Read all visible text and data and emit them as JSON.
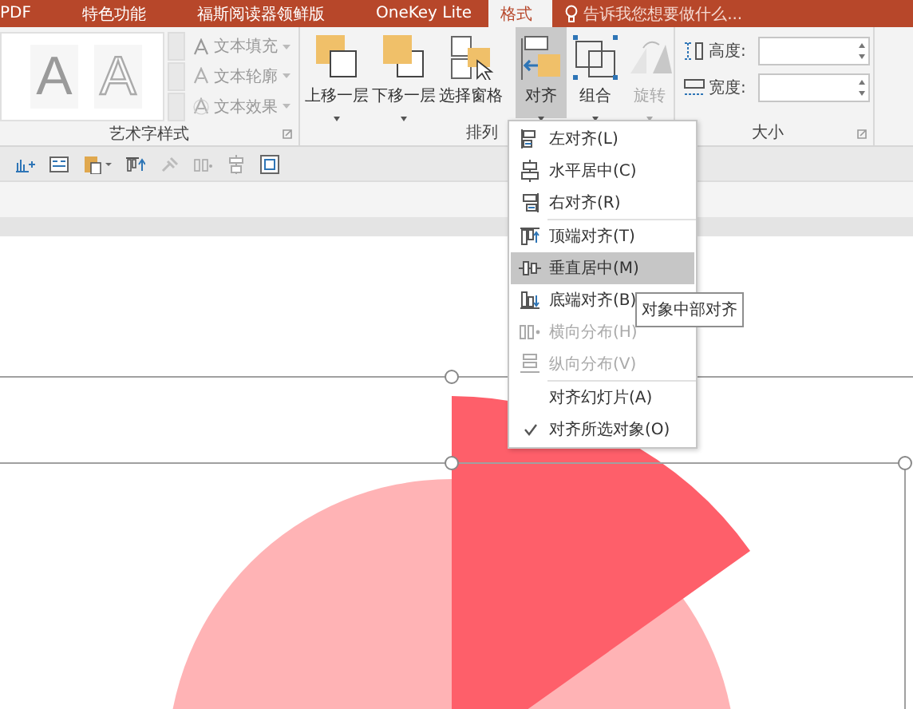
{
  "tabs": [
    {
      "label": "PDF",
      "selected": false
    },
    {
      "label": "特色功能",
      "selected": false
    },
    {
      "label": "福斯阅读器领鲜版",
      "selected": false
    },
    {
      "label": "OneKey Lite",
      "selected": false
    },
    {
      "label": "格式",
      "selected": true
    }
  ],
  "tell_me": {
    "placeholder": "告诉我您想要做什么..."
  },
  "wordart_group": {
    "label": "艺术字样式",
    "gallery": [
      {
        "label": "A"
      },
      {
        "label": "A"
      }
    ],
    "commands": [
      {
        "label": "文本填充"
      },
      {
        "label": "文本轮廓"
      },
      {
        "label": "文本效果"
      }
    ]
  },
  "arrange_group": {
    "label": "排列",
    "buttons": [
      {
        "label": "上移一层",
        "selected": false,
        "disabled": false,
        "dropdown": true
      },
      {
        "label": "下移一层",
        "selected": false,
        "disabled": false,
        "dropdown": true
      },
      {
        "label": "选择窗格",
        "selected": false,
        "disabled": false,
        "dropdown": false
      },
      {
        "label": "对齐",
        "selected": true,
        "disabled": false,
        "dropdown": true
      },
      {
        "label": "组合",
        "selected": false,
        "disabled": false,
        "dropdown": true
      },
      {
        "label": "旋转",
        "selected": false,
        "disabled": true,
        "dropdown": true
      }
    ]
  },
  "size_group": {
    "label": "大小",
    "fields": [
      {
        "label": "高度:"
      },
      {
        "label": "宽度:"
      }
    ]
  },
  "align_menu": {
    "sections": [
      {
        "items": [
          {
            "label": "左对齐(L)",
            "selected": false,
            "disabled": false,
            "checked": false
          },
          {
            "label": "水平居中(C)",
            "selected": false,
            "disabled": false,
            "checked": false
          },
          {
            "label": "右对齐(R)",
            "selected": false,
            "disabled": false,
            "checked": false
          }
        ]
      },
      {
        "items": [
          {
            "label": "顶端对齐(T)",
            "selected": false,
            "disabled": false,
            "checked": false
          },
          {
            "label": "垂直居中(M)",
            "selected": true,
            "disabled": false,
            "checked": false
          },
          {
            "label": "底端对齐(B)",
            "selected": false,
            "disabled": false,
            "checked": false
          },
          {
            "label": "横向分布(H)",
            "selected": false,
            "disabled": true,
            "checked": false
          },
          {
            "label": "纵向分布(V)",
            "selected": false,
            "disabled": true,
            "checked": false
          }
        ]
      },
      {
        "items": [
          {
            "label": "对齐幻灯片(A)",
            "selected": false,
            "disabled": false,
            "checked": false
          },
          {
            "label": "对齐所选对象(O)",
            "selected": false,
            "disabled": false,
            "checked": true
          }
        ]
      }
    ]
  },
  "tooltip": {
    "text": "对象中部对齐"
  }
}
